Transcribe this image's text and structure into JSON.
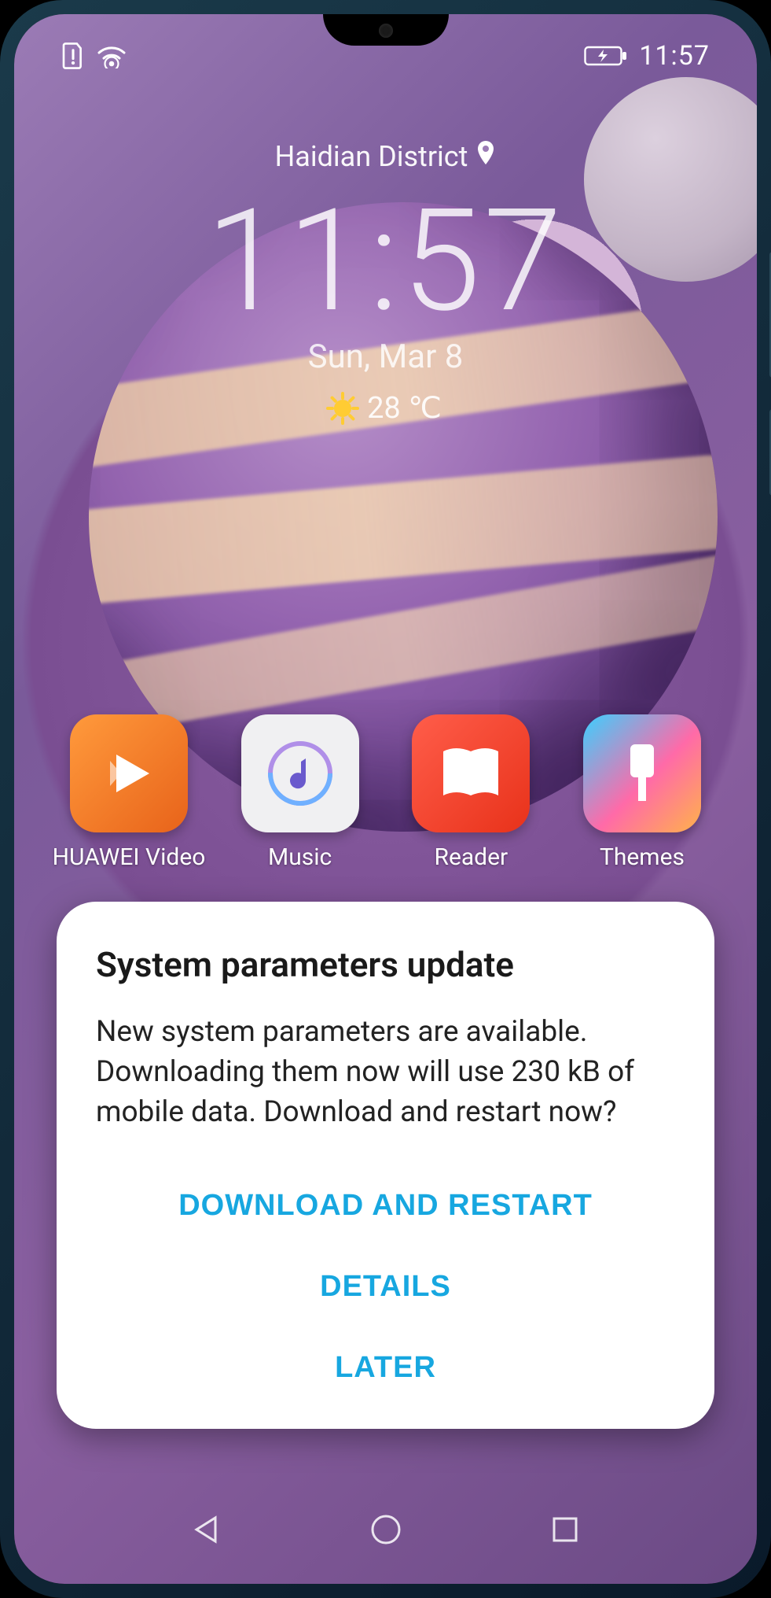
{
  "status": {
    "time": "11:57"
  },
  "lock": {
    "location": "Haidian District",
    "clock": "11:57",
    "date": "Sun, Mar 8",
    "temp": "28 ℃"
  },
  "apps": [
    {
      "label": "HUAWEI Video"
    },
    {
      "label": "Music"
    },
    {
      "label": "Reader"
    },
    {
      "label": "Themes"
    }
  ],
  "dialog": {
    "title": "System parameters update",
    "body": "New system parameters are available. Downloading them now will use 230 kB of mobile data. Download and restart now?",
    "btn_primary": "DOWNLOAD AND RESTART",
    "btn_details": "DETAILS",
    "btn_later": "LATER"
  }
}
